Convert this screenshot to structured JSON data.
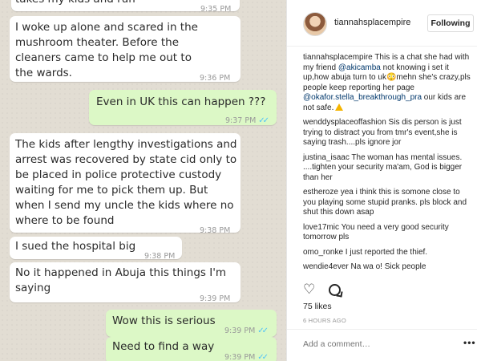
{
  "chat": {
    "messages": [
      {
        "text": "takes my kids and run",
        "time": "9:35 PM"
      },
      {
        "text": "I woke up alone and scared in the mushroom theater. Before the cleaners came to help me out to the wards.",
        "time": "9:36 PM"
      },
      {
        "text": "Even in UK this can happen ???",
        "time": "9:37 PM"
      },
      {
        "text": "The kids after lengthy investigations and arrest was recovered by state cid only to be placed in police protective custody waiting for me to pick them up. But when I send my uncle the kids where no where to be found",
        "time": "9:38 PM"
      },
      {
        "text": "I sued the hospital big",
        "time": "9:38 PM"
      },
      {
        "text": "No it happened in Abuja this things I'm saying",
        "time": "9:39 PM"
      },
      {
        "text": "Wow this is serious",
        "time": "9:39 PM"
      },
      {
        "text": "Need to find a way",
        "time": "9:39 PM"
      }
    ],
    "colors": {
      "incoming": "#ffffff",
      "outgoing": "#dcf8c6",
      "read_ticks": "#4fc3f7"
    },
    "read_ticks_icon": "double-check-icon"
  },
  "post": {
    "username": "tiannahsplacempire",
    "follow_label": "Following",
    "caption": {
      "user": "tiannahsplacempire",
      "text1": " This is a chat she had with my friend ",
      "mention1": "@akicamba",
      "text2": " not knowing i set it up,how abuja turn to uk",
      "emoji": "😳",
      "text3": "mehn she's crazy,pls people keep reporting her page ",
      "mention2": "@okafor.stella_breakthrough_pra",
      "text4": " our kids are not safe."
    },
    "comments": [
      {
        "user": "wenddysplaceoffashion",
        "text": " Sis dis person is just trying to distract you from tmr's event,she is saying trash....pls ignore jor"
      },
      {
        "user": "justina_isaac",
        "text": " The woman has mental issues. ....tighten your security ma'am, God is bigger than her"
      },
      {
        "user": "estheroze",
        "text": " yea i think this is somone close to you playing some stupid pranks. pls block and shut this down asap"
      },
      {
        "user": "love17mic",
        "text": " You need a very good security tomorrow pls"
      },
      {
        "user": "omo_ronke",
        "text": " I just reported the thief."
      },
      {
        "user": "wendie4ever",
        "text": " Na wa o! Sick people"
      }
    ],
    "likes": "75 likes",
    "time_ago": "6 HOURS AGO",
    "add_comment_placeholder": "Add a comment…",
    "more": "•••",
    "icons": {
      "like": "heart-icon",
      "comment": "comment-icon",
      "warning": "warning-icon"
    }
  }
}
